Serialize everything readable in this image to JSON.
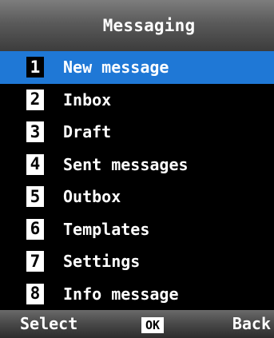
{
  "header": {
    "title": "Messaging"
  },
  "menu": {
    "selected_index": 0,
    "items": [
      {
        "number": "1",
        "label": "New message"
      },
      {
        "number": "2",
        "label": "Inbox"
      },
      {
        "number": "3",
        "label": "Draft"
      },
      {
        "number": "4",
        "label": "Sent messages"
      },
      {
        "number": "5",
        "label": "Outbox"
      },
      {
        "number": "6",
        "label": "Templates"
      },
      {
        "number": "7",
        "label": "Settings"
      },
      {
        "number": "8",
        "label": "Info message"
      }
    ]
  },
  "softkeys": {
    "left_label": "Select",
    "center_label": "OK",
    "right_label": "Back"
  },
  "colors": {
    "selection": "#1f78d6",
    "screen_background": "#000000",
    "text": "#ffffff",
    "page_background": "#e6eef5"
  }
}
